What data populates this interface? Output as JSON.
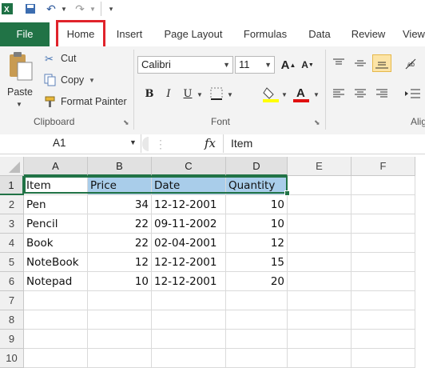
{
  "ribbon_tabs": [
    "File",
    "Home",
    "Insert",
    "Page Layout",
    "Formulas",
    "Data",
    "Review",
    "View"
  ],
  "clipboard": {
    "paste_label": "Paste",
    "cut_label": "Cut",
    "copy_label": "Copy",
    "format_painter_label": "Format Painter",
    "group_label": "Clipboard"
  },
  "font": {
    "name": "Calibri",
    "size": "11",
    "group_label": "Font",
    "bold": "B",
    "italic": "I",
    "underline": "U",
    "grow": "A",
    "shrink": "A"
  },
  "alignment": {
    "group_label": "Alig"
  },
  "formula_bar": {
    "name_box": "A1",
    "fx": "fx",
    "content": "Item"
  },
  "colors": {
    "file_tab": "#217346",
    "highlight": "#a9cdea",
    "home_outline": "#e0232b"
  },
  "columns": [
    "A",
    "B",
    "C",
    "D",
    "E",
    "F"
  ],
  "rows": [
    "1",
    "2",
    "3",
    "4",
    "5",
    "6",
    "7",
    "8",
    "9",
    "10"
  ],
  "table": [
    [
      "Item",
      "Price",
      "Date",
      "Quantity"
    ],
    [
      "Pen",
      "34",
      "12-12-2001",
      "10"
    ],
    [
      "Pencil",
      "22",
      "09-11-2002",
      "10"
    ],
    [
      "Book",
      "22",
      "02-04-2001",
      "12"
    ],
    [
      "NoteBook",
      "12",
      "12-12-2001",
      "15"
    ],
    [
      "Notepad",
      "10",
      "12-12-2001",
      "20"
    ]
  ]
}
